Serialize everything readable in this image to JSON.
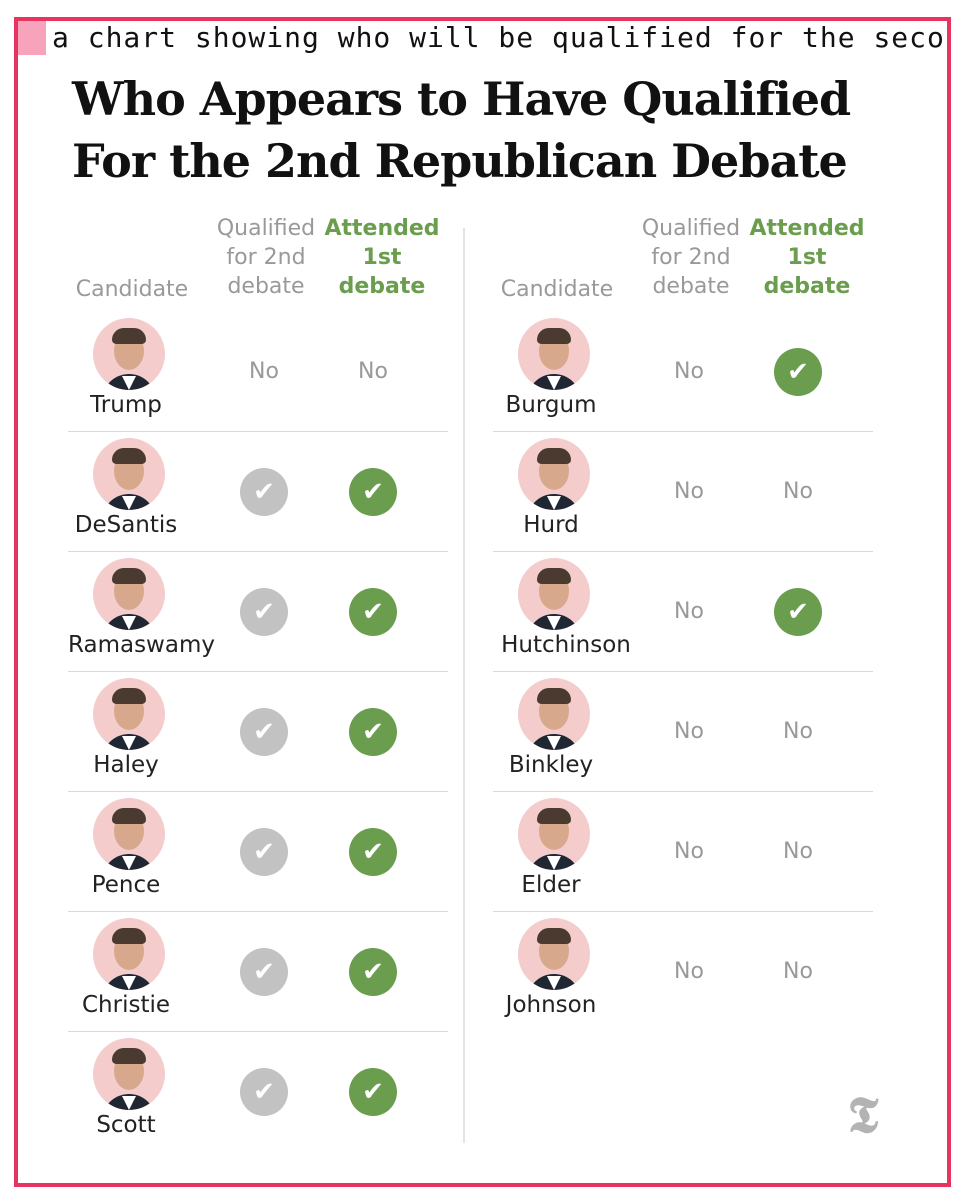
{
  "caption": "a chart showing who will be qualified for the second",
  "title_line1": "Who Appears to Have Qualified",
  "title_line2": "For the 2nd Republican Debate",
  "headers": {
    "candidate": "Candidate",
    "qualified_l1": "Qualified",
    "qualified_l2": "for 2nd",
    "qualified_l3": "debate",
    "attended_l1": "Attended",
    "attended_l2": "1st",
    "attended_l3": "debate"
  },
  "no_label": "No",
  "check_glyph": "✔",
  "colors": {
    "frame": "#e8325f",
    "green": "#6a9d4d",
    "grey_check": "#c2c2c2",
    "muted_text": "#999999"
  },
  "left_candidates": [
    {
      "name": "Trump",
      "qualified_2nd": false,
      "attended_1st": false
    },
    {
      "name": "DeSantis",
      "qualified_2nd": true,
      "attended_1st": true
    },
    {
      "name": "Ramaswamy",
      "qualified_2nd": true,
      "attended_1st": true
    },
    {
      "name": "Haley",
      "qualified_2nd": true,
      "attended_1st": true
    },
    {
      "name": "Pence",
      "qualified_2nd": true,
      "attended_1st": true
    },
    {
      "name": "Christie",
      "qualified_2nd": true,
      "attended_1st": true
    },
    {
      "name": "Scott",
      "qualified_2nd": true,
      "attended_1st": true
    }
  ],
  "right_candidates": [
    {
      "name": "Burgum",
      "qualified_2nd": false,
      "attended_1st": true
    },
    {
      "name": "Hurd",
      "qualified_2nd": false,
      "attended_1st": false
    },
    {
      "name": "Hutchinson",
      "qualified_2nd": false,
      "attended_1st": true
    },
    {
      "name": "Binkley",
      "qualified_2nd": false,
      "attended_1st": false
    },
    {
      "name": "Elder",
      "qualified_2nd": false,
      "attended_1st": false
    },
    {
      "name": "Johnson",
      "qualified_2nd": false,
      "attended_1st": false
    }
  ],
  "logo_icon": "nyt-t-logo-icon"
}
